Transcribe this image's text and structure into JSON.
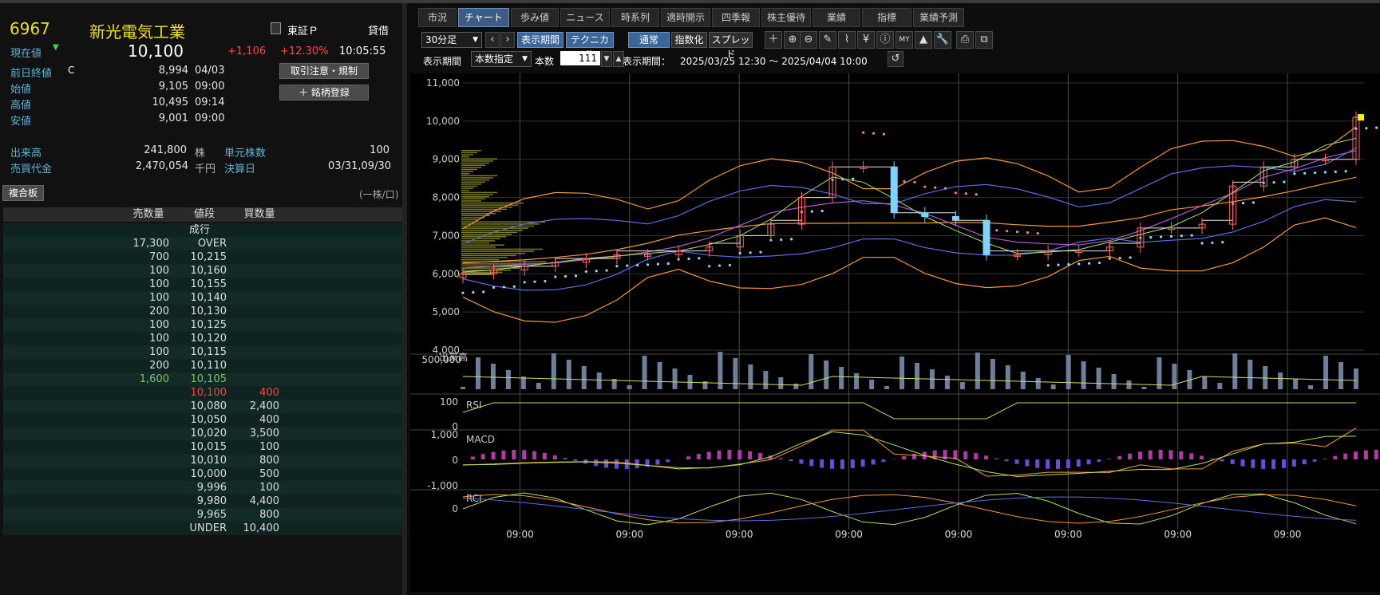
{
  "quote": {
    "code": "6967",
    "name": "新光電気工業",
    "market": "東証Ｐ",
    "lending": "貸借",
    "current_label": "現在値",
    "price": "10,100",
    "change": "+1,106",
    "change_pct": "+12.30%",
    "time": "10:05:55",
    "rows": [
      {
        "label": "前日終値",
        "flag": "C",
        "value": "8,994",
        "time": "04/03"
      },
      {
        "label": "始値",
        "value": "9,105",
        "time": "09:00"
      },
      {
        "label": "高値",
        "value": "10,495",
        "time": "09:14"
      },
      {
        "label": "安値",
        "value": "9,001",
        "time": "09:00"
      }
    ],
    "volume_label": "出来高",
    "volume": "241,800",
    "volume_unit": "株",
    "unit_label": "単元株数",
    "unit_value": "100",
    "turnover_label": "売買代金",
    "turnover": "2,470,054",
    "turnover_unit": "千円",
    "settle_label": "決算日",
    "settle_value": "03/31,09/30",
    "btn_caution": "取引注意・規制",
    "btn_register": "＋ 銘柄登録"
  },
  "board": {
    "title": "複合板",
    "unit_note": "(一株/口)",
    "headers": [
      "売数量",
      "値段",
      "買数量"
    ],
    "rows": [
      {
        "sell": "",
        "price": "成行",
        "buy": ""
      },
      {
        "sell": "17,300",
        "price": "OVER",
        "buy": ""
      },
      {
        "sell": "700",
        "price": "10,215",
        "buy": ""
      },
      {
        "sell": "100",
        "price": "10,160",
        "buy": ""
      },
      {
        "sell": "100",
        "price": "10,155",
        "buy": ""
      },
      {
        "sell": "100",
        "price": "10,140",
        "buy": ""
      },
      {
        "sell": "200",
        "price": "10,130",
        "buy": ""
      },
      {
        "sell": "100",
        "price": "10,125",
        "buy": ""
      },
      {
        "sell": "100",
        "price": "10,120",
        "buy": ""
      },
      {
        "sell": "100",
        "price": "10,115",
        "buy": ""
      },
      {
        "sell": "200",
        "price": "10,110",
        "buy": ""
      },
      {
        "sell": "1,600",
        "price": "10,105",
        "buy": "",
        "style": "ask"
      },
      {
        "sell": "",
        "price": "10,100",
        "buy": "400",
        "style": "bid"
      },
      {
        "sell": "",
        "price": "10,080",
        "buy": "2,400"
      },
      {
        "sell": "",
        "price": "10,050",
        "buy": "400"
      },
      {
        "sell": "",
        "price": "10,020",
        "buy": "3,500"
      },
      {
        "sell": "",
        "price": "10,015",
        "buy": "100"
      },
      {
        "sell": "",
        "price": "10,010",
        "buy": "800"
      },
      {
        "sell": "",
        "price": "10,000",
        "buy": "500"
      },
      {
        "sell": "",
        "price": "9,996",
        "buy": "100"
      },
      {
        "sell": "",
        "price": "9,980",
        "buy": "4,400"
      },
      {
        "sell": "",
        "price": "9,965",
        "buy": "800"
      },
      {
        "sell": "",
        "price": "UNDER",
        "buy": "10,400"
      }
    ]
  },
  "tabs": [
    "市況",
    "チャート",
    "歩み値",
    "ニュース",
    "時系列",
    "適時開示",
    "四季報",
    "株主優待",
    "業績",
    "指標",
    "業績予測"
  ],
  "active_tab": "チャート",
  "toolbar": {
    "interval": "30分足",
    "period_btn": "表示期間",
    "technical_btn": "テクニカル",
    "normal_btn": "通常",
    "index_btn": "指数化",
    "spread_btn": "スプレッド",
    "icons": [
      "crosshair-icon",
      "zoom-in-icon",
      "zoom-out-icon",
      "pencil-icon",
      "chart-style-icon",
      "yen-icon",
      "info-icon",
      "my-icon",
      "area-chart-icon",
      "wrench-icon",
      "print-icon",
      "export-icon"
    ],
    "icon_glyphs": [
      "＋",
      "⊕",
      "⊖",
      "✎",
      "⌇",
      "¥",
      "ⓘ",
      "MY",
      "▲",
      "🔧",
      "⎙",
      "⧉"
    ]
  },
  "period": {
    "label": "表示期間",
    "mode": "本数指定",
    "count_label": "本数",
    "count": "111",
    "range_label": "表示期間：",
    "range": "2025/03/25 12:30 ～ 2025/04/04 10:00"
  },
  "chart": {
    "price_ticks": [
      "11,000",
      "10,000",
      "9,000",
      "8,000",
      "7,000",
      "6,000",
      "5,000",
      "4,000"
    ],
    "x_ticks": [
      "09:00",
      "09:00",
      "09:00",
      "09:00",
      "09:00",
      "09:00",
      "09:00",
      "09:00"
    ],
    "volume_label": "出来高",
    "volume_tick": "500,000",
    "rsi_label": "RSI",
    "rsi_ticks": [
      "100",
      "0"
    ],
    "macd_label": "MACD",
    "macd_ticks": [
      "1,000",
      "0",
      "-1,000"
    ],
    "rci_label": "RCI",
    "rci_tick": "0",
    "colors": {
      "up": "#ff6b6b",
      "down": "#7fd3ff",
      "ma1": "#f39a3a",
      "ma2": "#b05ad0",
      "ma3": "#5a6ee0",
      "sar": "#ff8080"
    }
  },
  "chart_data": {
    "type": "candlestick",
    "interval": "30min",
    "range": "2025/03/25 12:30 ～ 2025/04/04 10:00",
    "sessions": [
      "09:00",
      "09:00",
      "09:00",
      "09:00",
      "09:00",
      "09:00",
      "09:00",
      "09:00"
    ],
    "ylim": [
      4000,
      11000
    ],
    "close": [
      6000,
      6100,
      6200,
      6300,
      6400,
      6500,
      6500,
      6600,
      6700,
      7000,
      7300,
      8000,
      8800,
      8800,
      7600,
      7500,
      7400,
      6500,
      6500,
      6600,
      6600,
      6700,
      7200,
      7200,
      7300,
      8300,
      8800,
      9000,
      9000,
      10100
    ],
    "volume_ylim": [
      0,
      500000
    ],
    "rsi_ylim": [
      0,
      100
    ],
    "macd_ylim": [
      -1000,
      1000
    ]
  }
}
